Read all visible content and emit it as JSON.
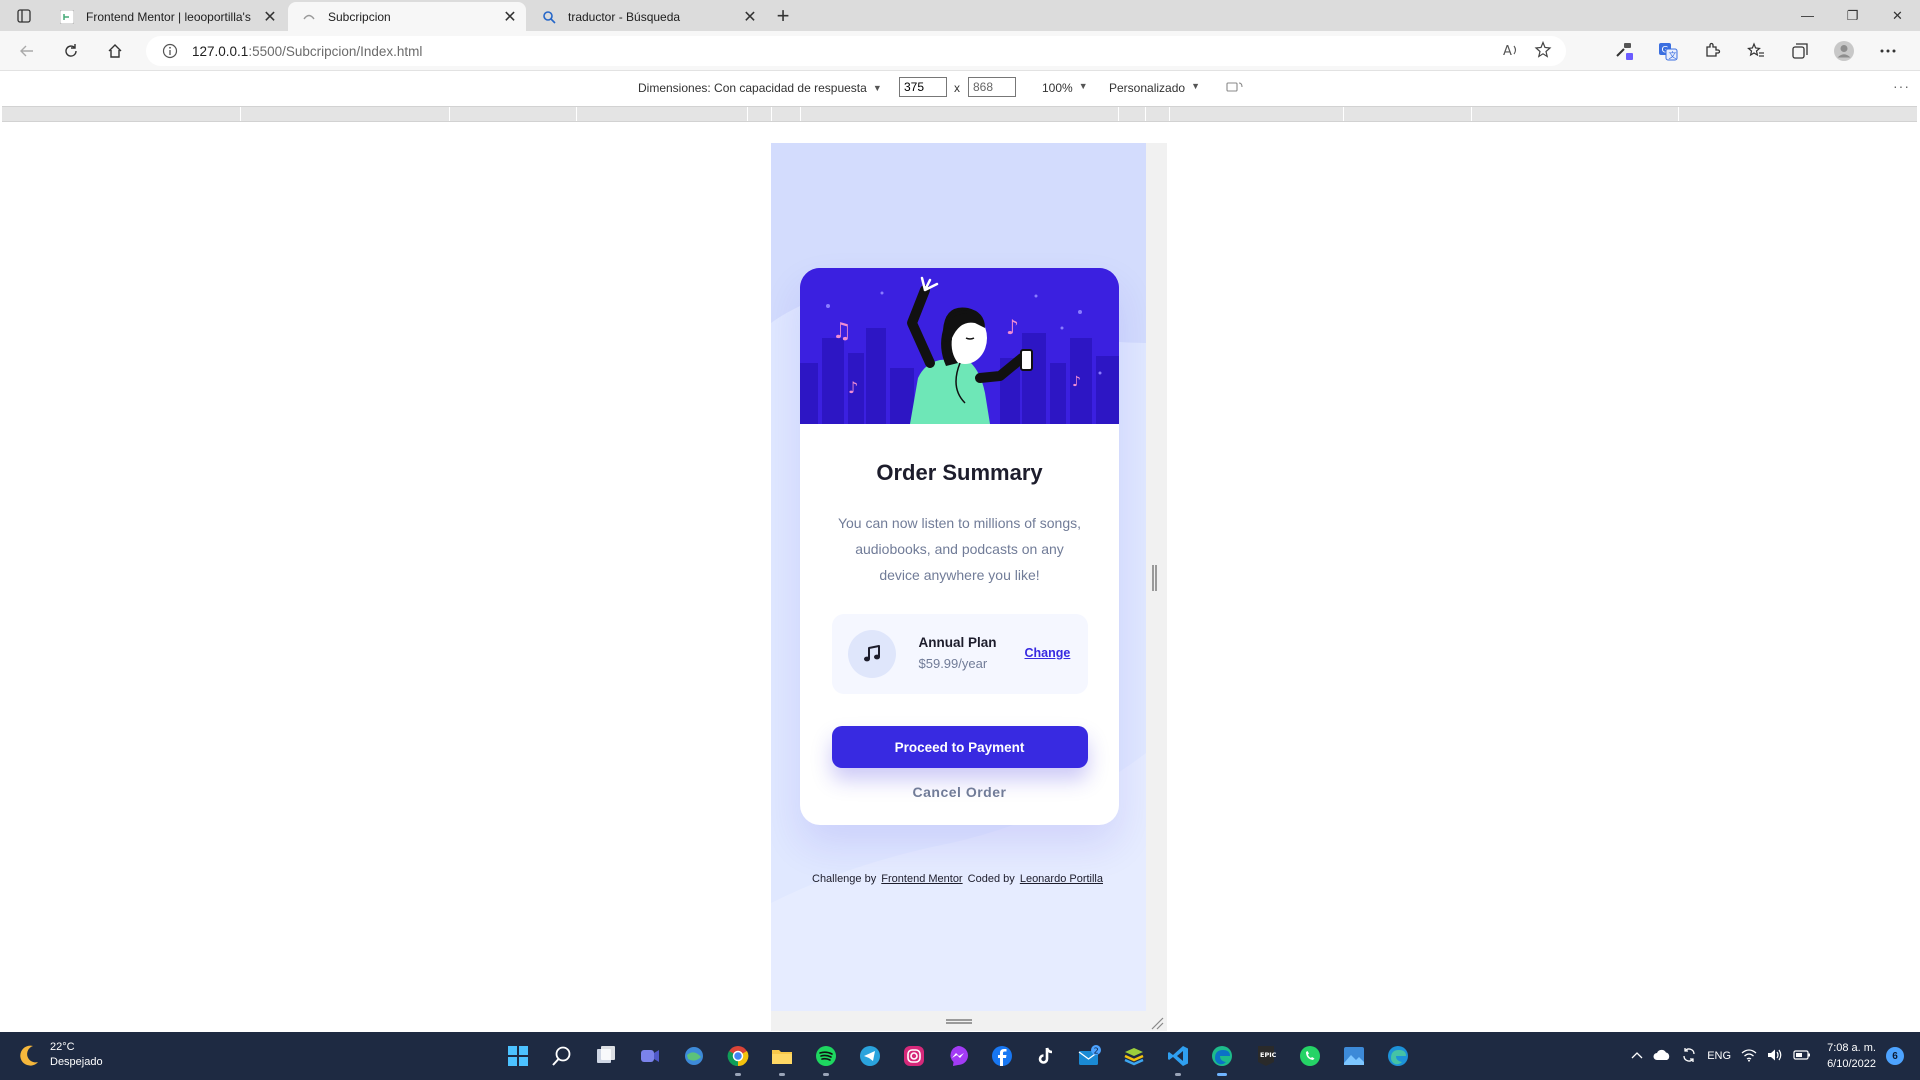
{
  "browser": {
    "tabs": [
      {
        "title": "Frontend Mentor | leooportilla's",
        "active": false
      },
      {
        "title": "Subcripcion",
        "active": true
      },
      {
        "title": "traductor - Búsqueda",
        "active": false
      }
    ],
    "url": {
      "host": "127.0.0.1",
      "rest": ":5500/Subcripcion/Index.html"
    }
  },
  "devtools": {
    "dimensions_label": "Dimensiones: Con capacidad de respuesta",
    "width_value": "375",
    "height_value": "868",
    "times": "x",
    "zoom": "100%",
    "throttle": "Personalizado",
    "more": "⋮"
  },
  "page": {
    "card": {
      "title": "Order Summary",
      "description": "You can now listen to millions of songs, audiobooks, and podcasts on any device anywhere you like!",
      "plan_name": "Annual Plan",
      "plan_price": "$59.99/year",
      "change_link": "Change",
      "pay_button": "Proceed to Payment",
      "cancel_button": "Cancel Order"
    },
    "attribution": {
      "challenge_by": "Challenge by",
      "frontend_mentor": "Frontend Mentor",
      "coded_by": "Coded by",
      "author": "Leonardo Portilla"
    }
  },
  "taskbar": {
    "weather_temp": "22°C",
    "weather_desc": "Despejado",
    "lang": "ENG",
    "time": "7:08 a. m.",
    "date": "6/10/2022",
    "notifications": "6",
    "mail_badge": "2"
  },
  "colors": {
    "accent": "#382ae1",
    "hero_bg": "#3b1fe0",
    "page_bg": "#e0e8ff",
    "taskbar": "#1e2a42"
  }
}
